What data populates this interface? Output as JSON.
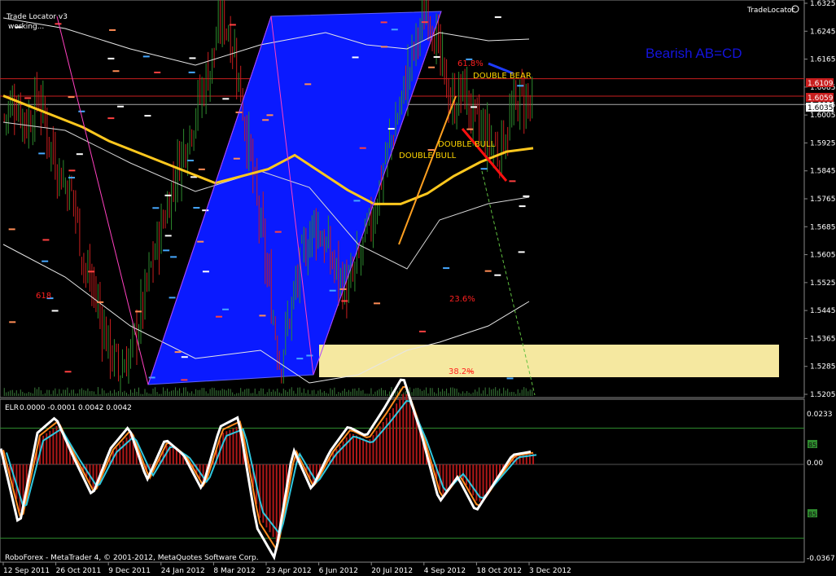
{
  "chart_data": {
    "type": "candlestick",
    "indicator_name": "Trade Locator v3",
    "indicator_status": "working...",
    "corner_label": "TradeLocator",
    "pattern_title": "Bearish AB=CD",
    "pattern_labels": [
      "DOUBLE  BEAR",
      "DOUBLE  BULL",
      "DOUBLE  BULL"
    ],
    "fib_labels": [
      "23.6%",
      "38.2%",
      "61.8%",
      "618"
    ],
    "price_axis": {
      "ticks": [
        "1.6325",
        "1.6245",
        "1.6165",
        "1.6085",
        "1.6035",
        "1.6005",
        "1.5925",
        "1.5845",
        "1.5765",
        "1.5685",
        "1.5605",
        "1.5525",
        "1.5445",
        "1.5365",
        "1.5285",
        "1.5205"
      ],
      "price_tags": [
        "1.6109",
        "1.6059",
        "1.6035"
      ],
      "range": [
        1.5205,
        1.6325
      ]
    },
    "time_axis": [
      "12 Sep 2011",
      "26 Oct 2011",
      "9 Dec 2011",
      "24 Jan 2012",
      "8 Mar 2012",
      "23 Apr 2012",
      "6 Jun 2012",
      "20 Jul 2012",
      "4 Sep 2012",
      "18 Oct 2012",
      "3 Dec 2012"
    ],
    "price_path": [
      1.6,
      1.605,
      1.598,
      1.606,
      1.592,
      1.583,
      1.577,
      1.557,
      1.548,
      1.535,
      1.527,
      1.532,
      1.545,
      1.56,
      1.572,
      1.585,
      1.595,
      1.605,
      1.615,
      1.63,
      1.62,
      1.598,
      1.575,
      1.553,
      1.53,
      1.545,
      1.56,
      1.57,
      1.563,
      1.555,
      1.55,
      1.56,
      1.57,
      1.585,
      1.597,
      1.61,
      1.623,
      1.632,
      1.615,
      1.603,
      1.608,
      1.598,
      1.594,
      1.59,
      1.598,
      1.606,
      1.603
    ],
    "moving_average": [
      1.606,
      1.603,
      1.6,
      1.597,
      1.593,
      1.59,
      1.587,
      1.584,
      1.581,
      1.583,
      1.585,
      1.589,
      1.584,
      1.579,
      1.575,
      1.575,
      1.578,
      1.583,
      1.587,
      1.59,
      1.591
    ],
    "oscillator": {
      "name": "ELR",
      "values_text": "0.0000 -0.0001 0.0042 0.0042",
      "ticks": [
        "0.0233",
        "0.00",
        "-0.0367"
      ],
      "level_tag": "85",
      "series": [
        0.005,
        -0.02,
        0.01,
        0.015,
        0.002,
        -0.01,
        0.005,
        0.012,
        -0.005,
        0.008,
        0.003,
        -0.008,
        0.012,
        0.015,
        -0.02,
        -0.03,
        0.005,
        -0.008,
        0.004,
        0.012,
        0.009,
        0.018,
        0.028,
        0.01,
        -0.012,
        -0.004,
        -0.015,
        -0.006,
        0.003,
        0.004
      ]
    },
    "footer": "RoboForex - MetaTrader 4, © 2001-2012, MetaQuotes Software Corp."
  },
  "colors": {
    "background": "#000000",
    "bull_candle": "#2e8b2e",
    "bear_candle": "#c81e1e",
    "pattern_fill": "#0a1aff",
    "ma": "#ffc81e",
    "highlight_zone": "#f5e8a0",
    "title_text": "#1414dc",
    "fib_text": "#ff2020",
    "label_text": "#ffd700"
  }
}
